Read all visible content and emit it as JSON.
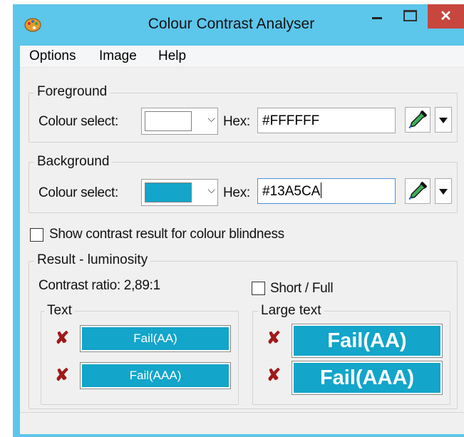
{
  "window": {
    "title": "Colour Contrast Analyser",
    "close_glyph": "✕"
  },
  "menu": [
    "Options",
    "Image",
    "Help"
  ],
  "foreground": {
    "group_label": "Foreground",
    "colour_select_label": "Colour select:",
    "swatch_color": "#FFFFFF",
    "hex_label": "Hex:",
    "hex_value": "#FFFFFF"
  },
  "background": {
    "group_label": "Background",
    "colour_select_label": "Colour select:",
    "swatch_color": "#13A5CA",
    "hex_label": "Hex:",
    "hex_value": "#13A5CA"
  },
  "colour_blindness": {
    "label": "Show contrast result for colour blindness",
    "checked": false
  },
  "result": {
    "group_label": "Result - luminosity",
    "contrast_ratio": "Contrast ratio: 2,89:1",
    "short_full_label": "Short / Full",
    "text_group": {
      "label": "Text",
      "rows": [
        {
          "status_icon": "cross-icon",
          "label": "Fail(AA)"
        },
        {
          "status_icon": "cross-icon",
          "label": "Fail(AAA)"
        }
      ]
    },
    "large_text_group": {
      "label": "Large text",
      "rows": [
        {
          "status_icon": "cross-icon",
          "label": "Fail(AA)"
        },
        {
          "status_icon": "cross-icon",
          "label": "Fail(AAA)"
        }
      ]
    }
  },
  "colors": {
    "accent": "#13A5CA",
    "fail_icon": "#A11A1A",
    "window_frame": "#5CC6EB",
    "close_button": "#C7463E"
  }
}
